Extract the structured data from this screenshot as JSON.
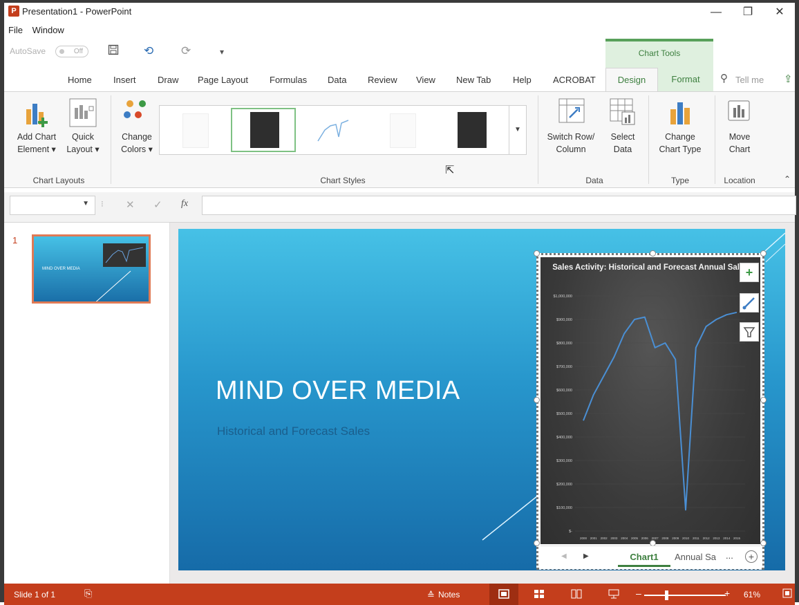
{
  "window": {
    "title": "Presentation1 - PowerPoint",
    "app_icon": "P",
    "minimize": "—",
    "restore": "❐",
    "close": "✕"
  },
  "menubar": {
    "file": "File",
    "window": "Window"
  },
  "qat": {
    "autosave_label": "AutoSave",
    "autosave_state": "Off"
  },
  "contextual": {
    "chart_tools": "Chart Tools"
  },
  "tabs": [
    "Home",
    "Insert",
    "Draw",
    "Page Layout",
    "Formulas",
    "Data",
    "Review",
    "View",
    "New Tab",
    "Help",
    "ACROBAT"
  ],
  "tab_design": "Design",
  "tab_format": "Format",
  "tellme": "Tell me",
  "ribbon": {
    "add_chart_element": [
      "Add Chart",
      "Element ▾"
    ],
    "quick_layout": [
      "Quick",
      "Layout ▾"
    ],
    "change_colors": [
      "Change",
      "Colors ▾"
    ],
    "switch_row_col": [
      "Switch Row/",
      "Column"
    ],
    "select_data": [
      "Select",
      "Data"
    ],
    "change_chart_type": [
      "Change",
      "Chart Type"
    ],
    "move_chart": [
      "Move",
      "Chart"
    ],
    "groups": {
      "chart_layouts": "Chart Layouts",
      "chart_styles": "Chart Styles",
      "data": "Data",
      "type": "Type",
      "location": "Location"
    }
  },
  "formula": {
    "fx": "fx",
    "cancel": "✕",
    "enter": "✓"
  },
  "slides_pane": {
    "slide_number": "1",
    "thumb_title": "MIND OVER MEDIA"
  },
  "slide": {
    "title": "MIND OVER MEDIA",
    "subtitle": "Historical and Forecast Sales"
  },
  "chart_data": {
    "type": "line",
    "title": "Sales Activity: Historical and Forecast Annual Sales",
    "y_ticks": [
      "$1,000,000",
      "$900,000",
      "$800,000",
      "$700,000",
      "$600,000",
      "$500,000",
      "$400,000",
      "$300,000",
      "$200,000",
      "$100,000",
      "$-"
    ],
    "ylim": [
      0,
      1000000
    ],
    "x": [
      "2000",
      "2001",
      "2002",
      "2003",
      "2004",
      "2005",
      "2006",
      "2007",
      "2008",
      "2009",
      "2010",
      "2011",
      "2012",
      "2013",
      "2014",
      "2015"
    ],
    "values": [
      470000,
      580000,
      660000,
      740000,
      840000,
      900000,
      910000,
      780000,
      800000,
      730000,
      90000,
      780000,
      870000,
      900000,
      920000,
      930000
    ],
    "line_color": "#4a8fd4",
    "grid": true
  },
  "sheet_tabs": {
    "active": "Chart1",
    "other": "Annual Sa",
    "more": "..."
  },
  "statusbar": {
    "slide_info": "Slide 1 of 1",
    "notes": "Notes",
    "zoom": "61%"
  },
  "colors": {
    "brand": "#c43e1c",
    "accent_green": "#3d7f3f"
  }
}
